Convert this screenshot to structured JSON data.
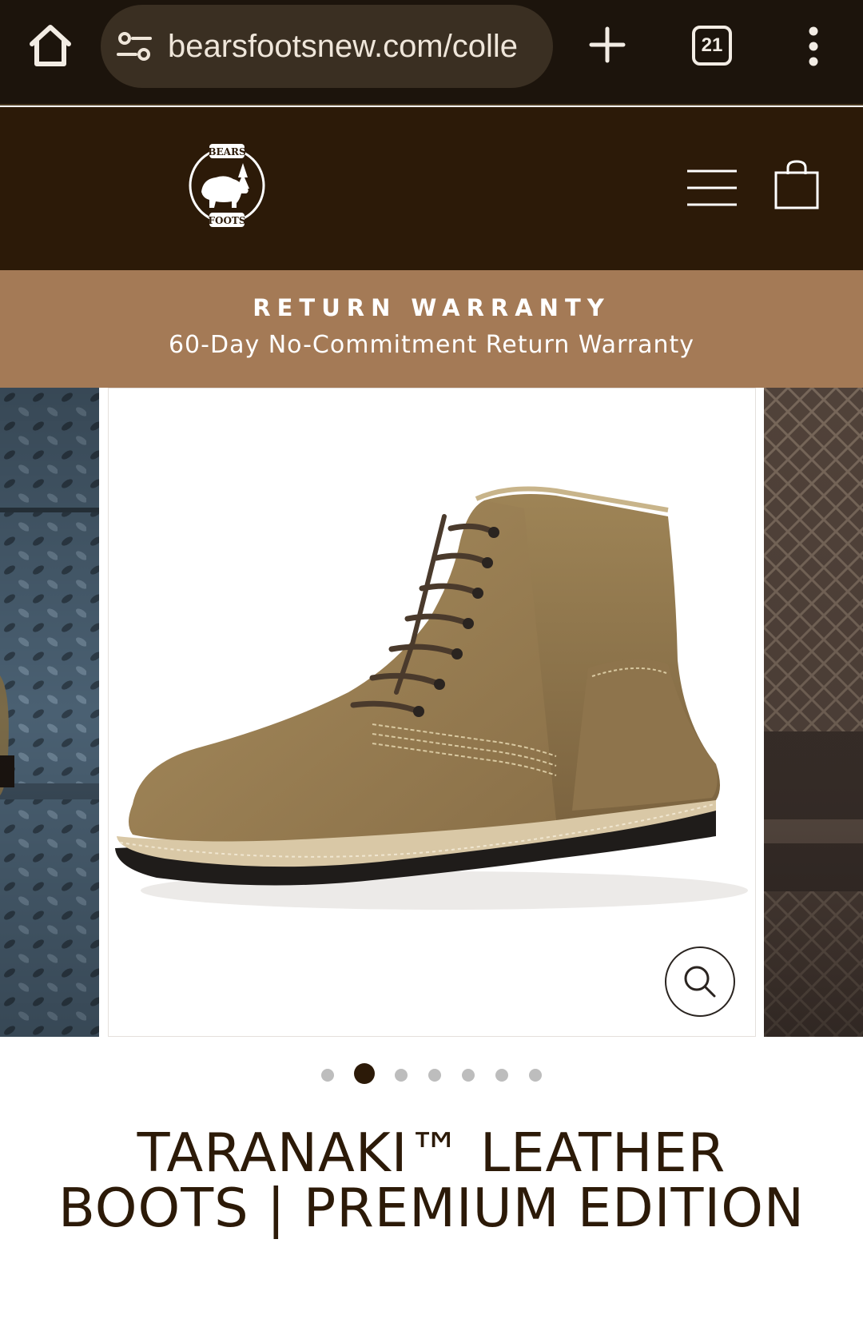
{
  "browser": {
    "url": "bearsfootsnew.com/colle",
    "tab_count": "21"
  },
  "header": {
    "logo_text_top": "BEARS",
    "logo_text_bottom": "FOOTS"
  },
  "announcement": {
    "title": "RETURN WARRANTY",
    "subtitle": "60-Day No-Commitment Return Warranty"
  },
  "gallery": {
    "slide_count": 7,
    "active_index": 1
  },
  "product": {
    "title": "TARANAKI™ LEATHER BOOTS | PREMIUM EDITION"
  },
  "colors": {
    "browser_bg": "#1c140c",
    "header_bg": "#2c1a08",
    "announce_bg": "#a47a56",
    "text_dark": "#2c1a08"
  }
}
